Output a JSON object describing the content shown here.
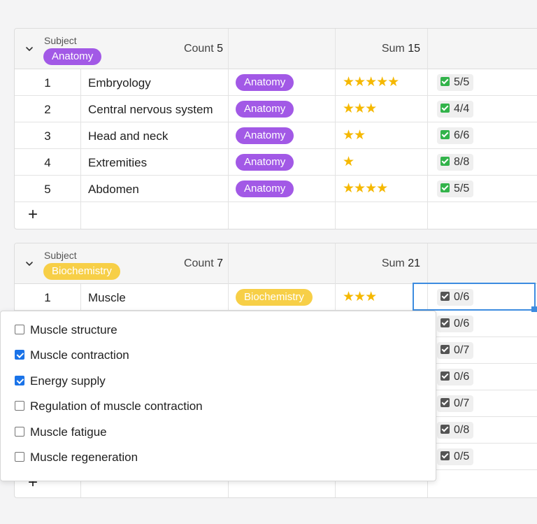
{
  "colors": {
    "anatomy": "#a259e6",
    "biochemistry": "#f7cf47",
    "star": "#f5b800",
    "check_done": "#32b34a",
    "check_pending": "#545454",
    "selection": "#3d8ce0"
  },
  "groups": [
    {
      "label": "Subject",
      "tag": "Anatomy",
      "count_label": "Count",
      "count_value": "5",
      "sum_label": "Sum",
      "sum_value": "15",
      "rows": [
        {
          "num": "1",
          "name": "Embryology",
          "tag": "Anatomy",
          "stars": "★★★★★",
          "rating": 5,
          "check": "5/5"
        },
        {
          "num": "2",
          "name": "Central nervous system",
          "tag": "Anatomy",
          "stars": "★★★",
          "rating": 3,
          "check": "4/4"
        },
        {
          "num": "3",
          "name": "Head and neck",
          "tag": "Anatomy",
          "stars": "★★",
          "rating": 2,
          "check": "6/6"
        },
        {
          "num": "4",
          "name": "Extremities",
          "tag": "Anatomy",
          "stars": "★",
          "rating": 1,
          "check": "8/8"
        },
        {
          "num": "5",
          "name": "Abdomen",
          "tag": "Anatomy",
          "stars": "★★★★",
          "rating": 4,
          "check": "5/5"
        }
      ],
      "add_label": "+"
    },
    {
      "label": "Subject",
      "tag": "Biochemistry",
      "count_label": "Count",
      "count_value": "7",
      "sum_label": "Sum",
      "sum_value": "21",
      "rows": [
        {
          "num": "1",
          "name": "Muscle",
          "tag": "Biochemistry",
          "stars": "★★★",
          "rating": 3,
          "check": "0/6"
        },
        {
          "check": "0/6"
        },
        {
          "check": "0/7"
        },
        {
          "check": "0/6"
        },
        {
          "check": "0/7"
        },
        {
          "check": "0/8"
        },
        {
          "check": "0/5"
        }
      ],
      "add_label": "+"
    }
  ],
  "popup": {
    "options": [
      {
        "label": "Muscle structure",
        "checked": false
      },
      {
        "label": "Muscle contraction",
        "checked": true
      },
      {
        "label": "Energy supply",
        "checked": true
      },
      {
        "label": "Regulation of muscle contraction",
        "checked": false
      },
      {
        "label": "Muscle fatigue",
        "checked": false
      },
      {
        "label": "Muscle regeneration",
        "checked": false
      }
    ]
  }
}
